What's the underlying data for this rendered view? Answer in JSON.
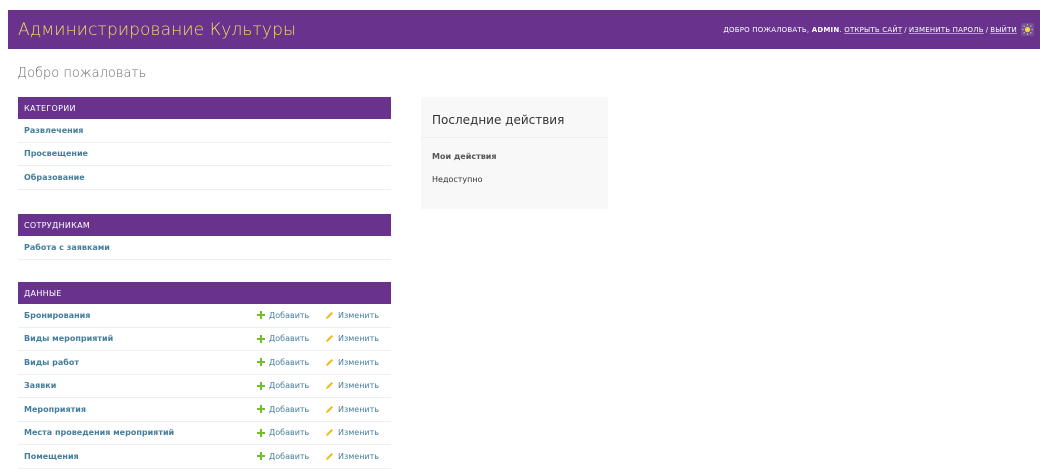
{
  "header": {
    "brand": "Администрирование Культуры",
    "welcome": "Добро пожаловать,",
    "username": "admin",
    "view_site": "Открыть сайт",
    "change_password": "Изменить пароль",
    "logout": "Выйти",
    "separator": "/"
  },
  "page_title": "Добро пожаловать",
  "modules": [
    {
      "caption": "Категории",
      "rows": [
        {
          "label": "Развлечения"
        },
        {
          "label": "Просвещение"
        },
        {
          "label": "Образование"
        }
      ]
    },
    {
      "caption": "Сотрудникам",
      "rows": [
        {
          "label": "Работа с заявками"
        }
      ]
    },
    {
      "caption": "Данные",
      "rows": [
        {
          "label": "Бронирования",
          "add": "Добавить",
          "change": "Изменить"
        },
        {
          "label": "Виды мероприятий",
          "add": "Добавить",
          "change": "Изменить"
        },
        {
          "label": "Виды работ",
          "add": "Добавить",
          "change": "Изменить"
        },
        {
          "label": "Заявки",
          "add": "Добавить",
          "change": "Изменить"
        },
        {
          "label": "Мероприятия",
          "add": "Добавить",
          "change": "Изменить"
        },
        {
          "label": "Места проведения мероприятий",
          "add": "Добавить",
          "change": "Изменить"
        },
        {
          "label": "Помещения",
          "add": "Добавить",
          "change": "Изменить"
        }
      ]
    }
  ],
  "recent_actions": {
    "title": "Последние действия",
    "subtitle": "Мои действия",
    "empty": "Недоступно"
  },
  "colors": {
    "header_bg": "#69338d",
    "brand_text": "#f5dd5d",
    "link": "#447e9b",
    "add_icon": "#70bf2b",
    "change_icon": "#efb80b"
  },
  "icons": {
    "add": "plus-icon",
    "change": "pencil-icon",
    "theme": "theme-toggle-icon"
  }
}
